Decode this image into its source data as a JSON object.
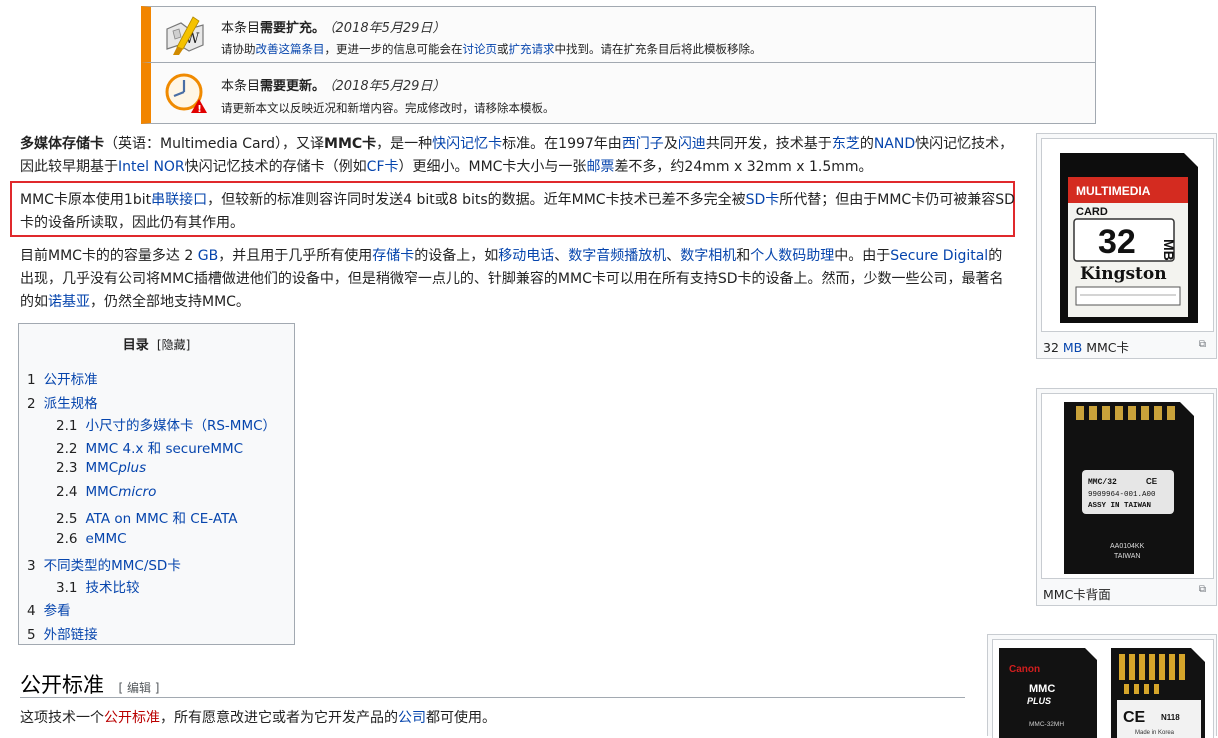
{
  "notices": [
    {
      "prefix": "本条目",
      "strong": "需要扩充。",
      "date": "（2018年5月29日）",
      "line2": [
        {
          "t": "请协助"
        },
        {
          "t": "改善这篇条目",
          "link": true
        },
        {
          "t": "，更进一步的信息可能会在"
        },
        {
          "t": "讨论页",
          "link": true
        },
        {
          "t": "或"
        },
        {
          "t": "扩充请求",
          "link": true
        },
        {
          "t": "中找到。请在扩充条目后将此模板移除。"
        }
      ]
    },
    {
      "prefix": "本条目",
      "strong": "需要更新。",
      "date": "（2018年5月29日）",
      "line2": [
        {
          "t": "请更新本文以反映近况和新增内容。完成修改时，请移除本模板。"
        }
      ]
    }
  ],
  "paragraphs": [
    [
      {
        "t": "多媒体存储卡",
        "b": true
      },
      {
        "t": "（英语：Multimedia Card），又译"
      },
      {
        "t": "MMC卡",
        "b": true
      },
      {
        "t": "，是一种"
      },
      {
        "t": "快闪记忆卡",
        "link": true
      },
      {
        "t": "标准。在1997年由"
      },
      {
        "t": "西门子",
        "link": true
      },
      {
        "t": "及"
      },
      {
        "t": "闪迪",
        "link": true
      },
      {
        "t": "共同开发，技术基于"
      },
      {
        "t": "东芝",
        "link": true
      },
      {
        "t": "的"
      },
      {
        "t": "NAND",
        "link": true
      },
      {
        "t": "快闪记忆技术，因此较早期基于"
      },
      {
        "t": "Intel NOR",
        "link": true
      },
      {
        "t": "快闪记忆技术的存储卡（例如"
      },
      {
        "t": "CF卡",
        "link": true
      },
      {
        "t": "）更细小。MMC卡大小与一张"
      },
      {
        "t": "邮票",
        "link": true
      },
      {
        "t": "差不多，约24mm x 32mm x 1.5mm。"
      }
    ],
    [
      {
        "t": "MMC卡原本使用1bit"
      },
      {
        "t": "串联接口",
        "link": true
      },
      {
        "t": "，但较新的标准则容许同时发送4 bit或8 bits的数据。近年MMC卡技术已差不多完全被"
      },
      {
        "t": "SD卡",
        "link": true
      },
      {
        "t": "所代替；但由于MMC卡仍可被兼容SD卡的设备所读取，因此仍有其作用。"
      }
    ],
    [
      {
        "t": "目前MMC卡的的容量多达 2 "
      },
      {
        "t": "GB",
        "link": true
      },
      {
        "t": "，并且用于几乎所有使用"
      },
      {
        "t": "存储卡",
        "link": true
      },
      {
        "t": "的设备上，如"
      },
      {
        "t": "移动电话",
        "link": true
      },
      {
        "t": "、"
      },
      {
        "t": "数字音频播放机",
        "link": true
      },
      {
        "t": "、"
      },
      {
        "t": "数字相机",
        "link": true
      },
      {
        "t": "和"
      },
      {
        "t": "个人数码助理",
        "link": true
      },
      {
        "t": "中。由于"
      },
      {
        "t": "Secure Digital",
        "link": true
      },
      {
        "t": "的出现，几乎没有公司将MMC插槽做进他们的设备中，但是稍微窄一点儿的、针脚兼容的MMC卡可以用在所有支持SD卡的设备上。然而，少数一些公司，最著名的如"
      },
      {
        "t": "诺基亚",
        "link": true
      },
      {
        "t": "，仍然全部地支持MMC。"
      }
    ]
  ],
  "toc": {
    "title": "目录",
    "hide": "[隐藏]",
    "items": [
      {
        "num": "1",
        "label": "公开标准"
      },
      {
        "num": "2",
        "label": "派生规格"
      },
      {
        "num": "2.1",
        "label": "小尺寸的多媒体卡（RS-MMC）"
      },
      {
        "num": "2.2",
        "label": "MMC 4.x 和 secureMMC"
      },
      {
        "num": "2.3",
        "label": "MMC",
        "suffix": "plus"
      },
      {
        "num": "2.4",
        "label": "MMC",
        "suffix": "micro"
      },
      {
        "num": "2.5",
        "label": "ATA on MMC 和 CE-ATA"
      },
      {
        "num": "2.6",
        "label": "eMMC"
      },
      {
        "num": "3",
        "label": "不同类型的MMC/SD卡"
      },
      {
        "num": "3.1",
        "label": "技术比较"
      },
      {
        "num": "4",
        "label": "参看"
      },
      {
        "num": "5",
        "label": "外部链接"
      }
    ]
  },
  "section": {
    "title": "公开标准",
    "edit": "[ 编辑 ]",
    "text": [
      {
        "t": "这项技术一个"
      },
      {
        "t": "公开标准",
        "red": true
      },
      {
        "t": "，所有愿意改进它或者为它开发产品的"
      },
      {
        "t": "公司",
        "link": true
      },
      {
        "t": "都可使用。"
      }
    ]
  },
  "thumbs": {
    "front": {
      "caption_num": "32 ",
      "caption_link": "MB",
      "caption_rest": " MMC卡",
      "label_top": "MULTIMEDIA",
      "label_card": "CARD",
      "capacity": "32",
      "unit": "MB",
      "brand": "Kingston"
    },
    "back": {
      "caption": "MMC卡背面",
      "line1": "MMC/32",
      "ce": "CE",
      "line2": "9909964-001.A00",
      "line3": "ASSY IN TAIWAN",
      "line4": "AA0104KK",
      "line5": "TAIWAN"
    },
    "third": {
      "brand": "Canon",
      "model": "MMC",
      "plus": "PLUS",
      "sku": "MMC-32MH",
      "ce": "CE",
      "code": "N118",
      "made": "Made in Korea"
    }
  }
}
